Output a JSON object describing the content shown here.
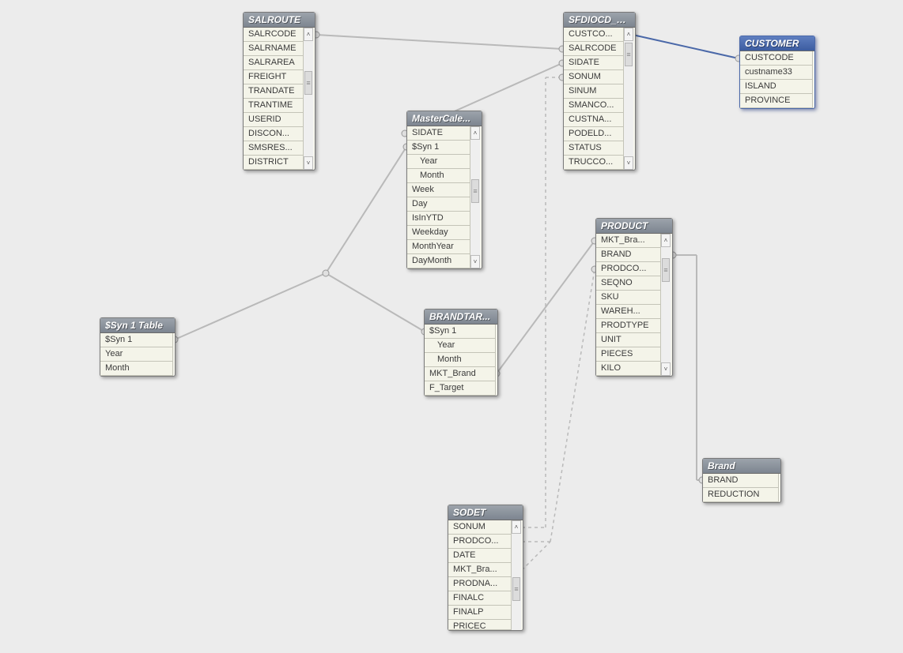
{
  "tables": {
    "salroute": {
      "title": "SALROUTE",
      "fields": [
        "SALRCODE",
        "SALRNAME",
        "SALRAREA",
        "FREIGHT",
        "TRANDATE",
        "TRANTIME",
        "USERID",
        "DISCON...",
        "SMSRES...",
        "DISTRICT"
      ]
    },
    "sfdiocd": {
      "title": "SFDIOCD_S...",
      "fields": [
        "CUSTCO...",
        "SALRCODE",
        "SIDATE",
        "SONUM",
        "SINUM",
        "SMANCO...",
        "CUSTNA...",
        "PODELD...",
        "STATUS",
        "TRUCCO..."
      ]
    },
    "customer": {
      "title": "CUSTOMER",
      "fields": [
        "CUSTCODE",
        "custname33",
        "ISLAND",
        "PROVINCE"
      ]
    },
    "mastercal": {
      "title": "MasterCale...",
      "fields": [
        {
          "t": "SIDATE"
        },
        {
          "t": "$Syn 1"
        },
        {
          "t": "Year",
          "i": 1
        },
        {
          "t": "Month",
          "i": 1
        },
        {
          "t": "Week"
        },
        {
          "t": "Day"
        },
        {
          "t": "IsInYTD"
        },
        {
          "t": "Weekday"
        },
        {
          "t": "MonthYear"
        },
        {
          "t": "DayMonth"
        }
      ]
    },
    "syn1": {
      "title": "$Syn 1 Table",
      "fields": [
        "$Syn 1",
        "Year",
        "Month"
      ]
    },
    "brandtar": {
      "title": "BRANDTAR...",
      "fields": [
        {
          "t": "$Syn 1"
        },
        {
          "t": "Year",
          "i": 1
        },
        {
          "t": "Month",
          "i": 1
        },
        {
          "t": "MKT_Brand"
        },
        {
          "t": "F_Target"
        }
      ]
    },
    "product": {
      "title": "PRODUCT",
      "fields": [
        "MKT_Bra...",
        "BRAND",
        "PRODCO...",
        "SEQNO",
        "SKU",
        "WAREH...",
        "PRODTYPE",
        "UNIT",
        "PIECES",
        "KILO"
      ]
    },
    "brand": {
      "title": "Brand",
      "fields": [
        "BRAND",
        "REDUCTION"
      ]
    },
    "sodet": {
      "title": "SODET",
      "fields": [
        "SONUM",
        "PRODCO...",
        "DATE",
        "MKT_Bra...",
        "PRODNA...",
        "FINALC",
        "FINALP",
        "PRICEC"
      ]
    }
  },
  "scroll": {
    "up": "˄",
    "down": "˅",
    "grip": "≡"
  }
}
